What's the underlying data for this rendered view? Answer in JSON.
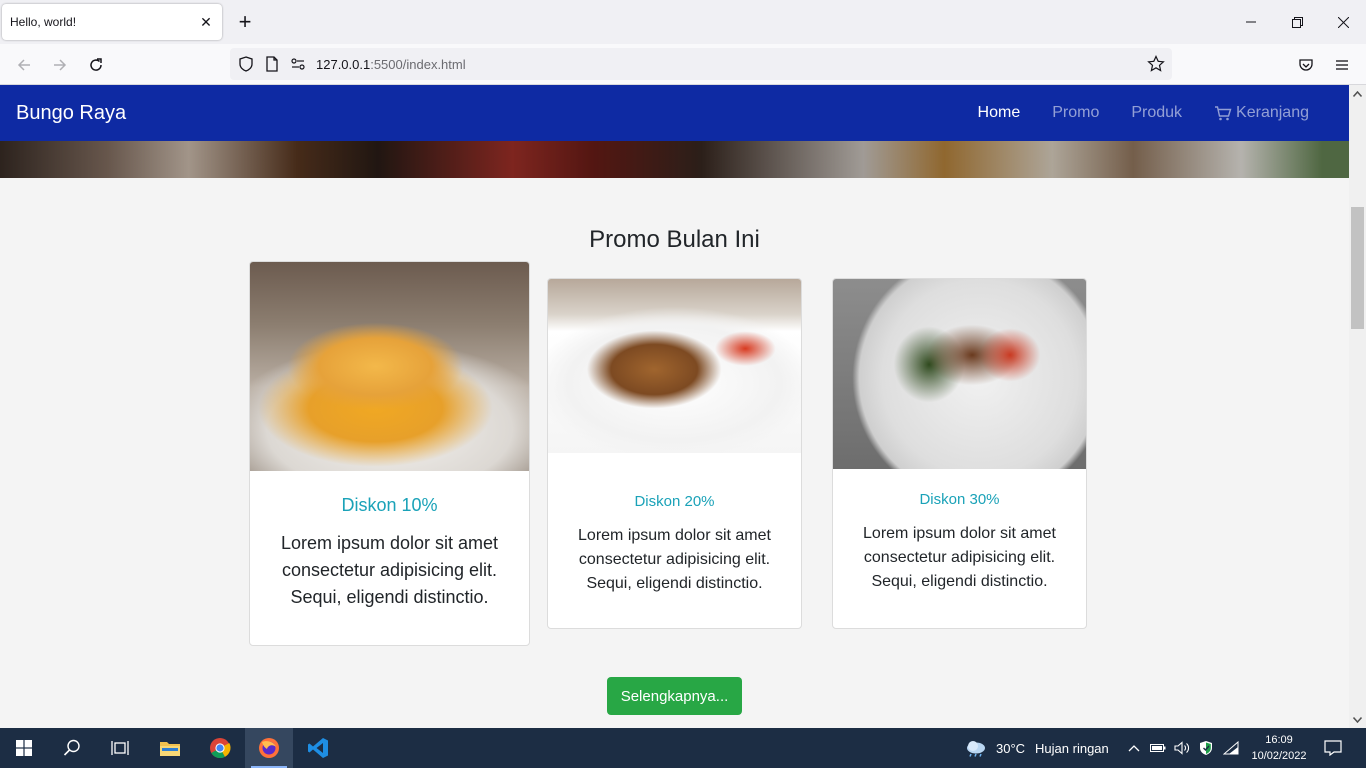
{
  "browser": {
    "tab_title": "Hello, world!",
    "url_host": "127.0.0.1",
    "url_rest": ":5500/index.html"
  },
  "site": {
    "brand": "Bungo Raya",
    "nav": [
      {
        "label": "Home",
        "active": true
      },
      {
        "label": "Promo",
        "active": false
      },
      {
        "label": "Produk",
        "active": false
      },
      {
        "label": "Keranjang",
        "active": false,
        "icon": "cart-icon"
      }
    ],
    "section_title": "Promo Bulan Ini",
    "cards": [
      {
        "title": "Diskon 10%",
        "text": "Lorem ipsum dolor sit amet consectetur adipisicing elit. Sequi, eligendi distinctio."
      },
      {
        "title": "Diskon 20%",
        "text": "Lorem ipsum dolor sit amet consectetur adipisicing elit. Sequi, eligendi distinctio."
      },
      {
        "title": "Diskon 30%",
        "text": "Lorem ipsum dolor sit amet consectetur adipisicing elit. Sequi, eligendi distinctio."
      }
    ],
    "more_button": "Selengkapnya..."
  },
  "taskbar": {
    "weather_temp": "30°C",
    "weather_desc": "Hujan ringan",
    "time": "16:09",
    "date": "10/02/2022"
  },
  "colors": {
    "navbar": "#0e2aa3",
    "card_title": "#1aa2b8",
    "button": "#28a745",
    "taskbar": "#1c2d44"
  }
}
